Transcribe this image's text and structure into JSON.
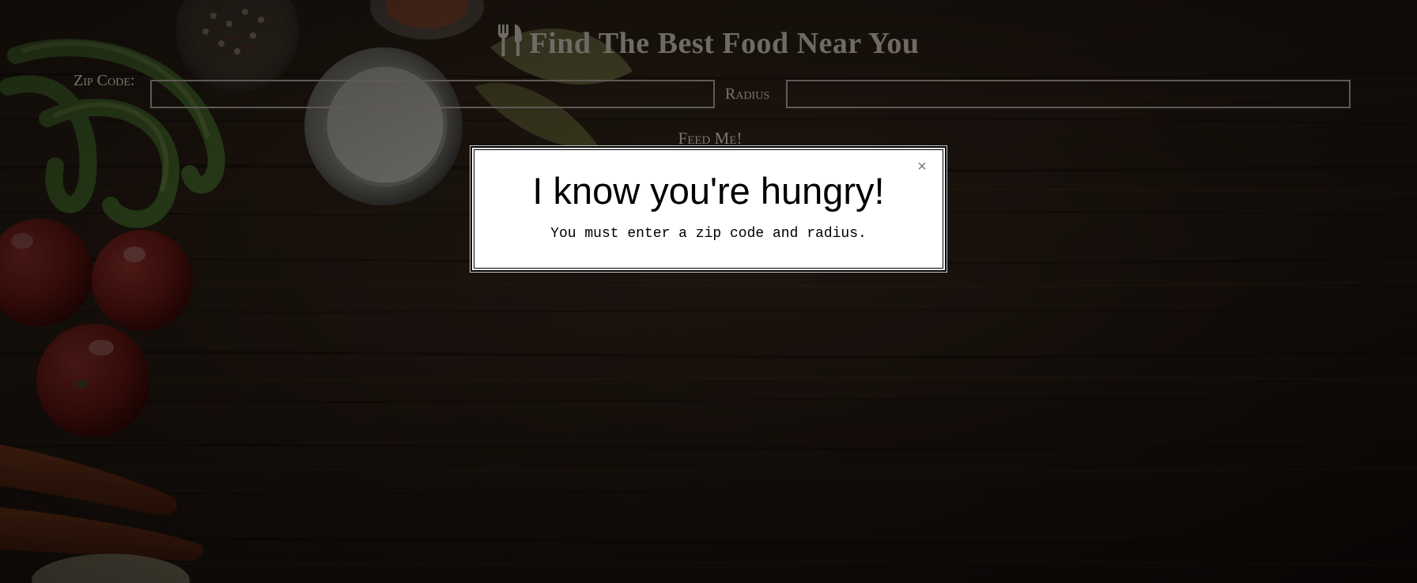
{
  "header": {
    "icon": "utensils-icon",
    "title": "Find The Best Food Near You"
  },
  "form": {
    "zip_label": "Zip Code:",
    "zip_value": "",
    "radius_label": "Radius",
    "radius_value": "",
    "submit_label": "Feed Me!"
  },
  "modal": {
    "close_label": "×",
    "heading": "I know you're hungry!",
    "message": "You must enter a zip code and radius."
  },
  "background": {
    "description_icon": "wood-table-vegetables-image",
    "wood_color": "#2e1f15",
    "overlay_color": "#000000"
  }
}
